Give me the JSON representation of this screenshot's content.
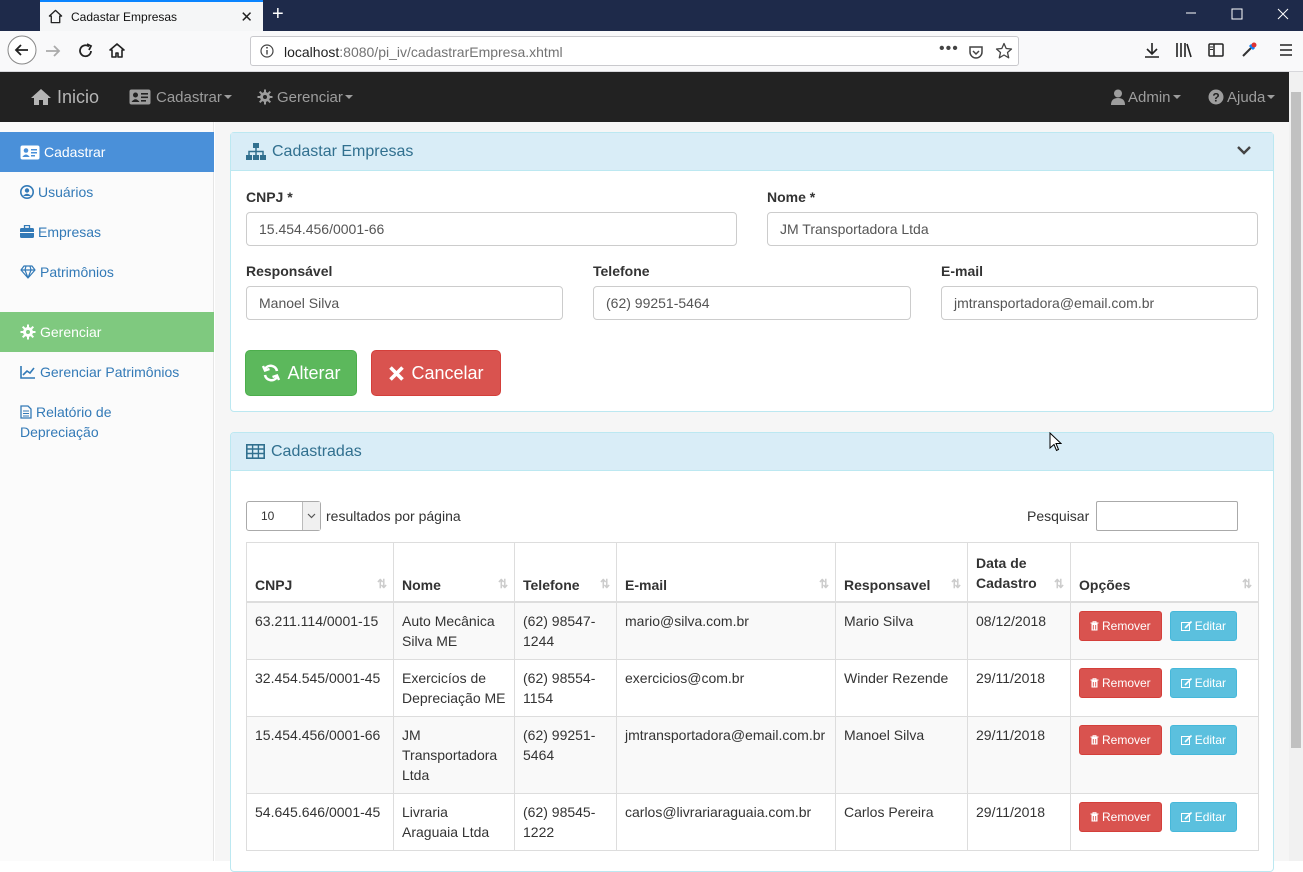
{
  "browser": {
    "tab_title": "Cadastar Empresas",
    "url_host": "localhost",
    "url_rest": ":8080/pi_iv/cadastrarEmpresa.xhtml"
  },
  "appnav": {
    "brand": "Inicio",
    "cadastrar": "Cadastrar",
    "gerenciar": "Gerenciar",
    "admin": "Admin",
    "ajuda": "Ajuda"
  },
  "sidebar": {
    "cadastrar_header": "Cadastrar",
    "usuarios": "Usuários",
    "empresas": "Empresas",
    "patrimonios": "Patrimônios",
    "gerenciar_header": "Gerenciar",
    "gerenciar_patrimonios": "Gerenciar Patrimônios",
    "relatorio": "Relatório de Depreciação"
  },
  "form": {
    "title": "Cadastar Empresas",
    "cnpj_label": "CNPJ *",
    "cnpj_value": "15.454.456/0001-66",
    "nome_label": "Nome *",
    "nome_value": "JM Transportadora Ltda",
    "responsavel_label": "Responsável",
    "responsavel_value": "Manoel Silva",
    "telefone_label": "Telefone",
    "telefone_value": "(62) 99251-5464",
    "email_label": "E-mail",
    "email_value": "jmtransportadora@email.com.br",
    "alterar": "Alterar",
    "cancelar": "Cancelar"
  },
  "list": {
    "title": "Cadastradas",
    "page_size": "10",
    "page_size_label": "resultados por página",
    "search_label": "Pesquisar",
    "search_value": "",
    "columns": [
      "CNPJ",
      "Nome",
      "Telefone",
      "E-mail",
      "Responsavel",
      "Data de Cadastro",
      "Opções"
    ],
    "remove_label": "Remover",
    "edit_label": "Editar",
    "rows": [
      {
        "cnpj": "63.211.114/0001-15",
        "nome": "Auto Mecânica Silva ME",
        "telefone": "(62) 98547-1244",
        "email": "mario@silva.com.br",
        "responsavel": "Mario Silva",
        "data": "08/12/2018"
      },
      {
        "cnpj": "32.454.545/0001-45",
        "nome": "Exercicíos de Depreciação ME",
        "telefone": "(62) 98554-1154",
        "email": "exercicios@com.br",
        "responsavel": "Winder Rezende",
        "data": "29/11/2018"
      },
      {
        "cnpj": "15.454.456/0001-66",
        "nome": "JM Transportadora Ltda",
        "telefone": "(62) 99251-5464",
        "email": "jmtransportadora@email.com.br",
        "responsavel": "Manoel Silva",
        "data": "29/11/2018"
      },
      {
        "cnpj": "54.645.646/0001-45",
        "nome": "Livraria Araguaia Ltda",
        "telefone": "(62) 98545-1222",
        "email": "carlos@livrariaraguaia.com.br",
        "responsavel": "Carlos Pereira",
        "data": "29/11/2018"
      }
    ]
  },
  "colors": {
    "primary": "#337ab7",
    "success": "#5cb85c",
    "danger": "#d9534f",
    "info": "#5bc0de",
    "sidebar_active": "#4a90d9",
    "sidebar_green": "#7fc97f"
  }
}
